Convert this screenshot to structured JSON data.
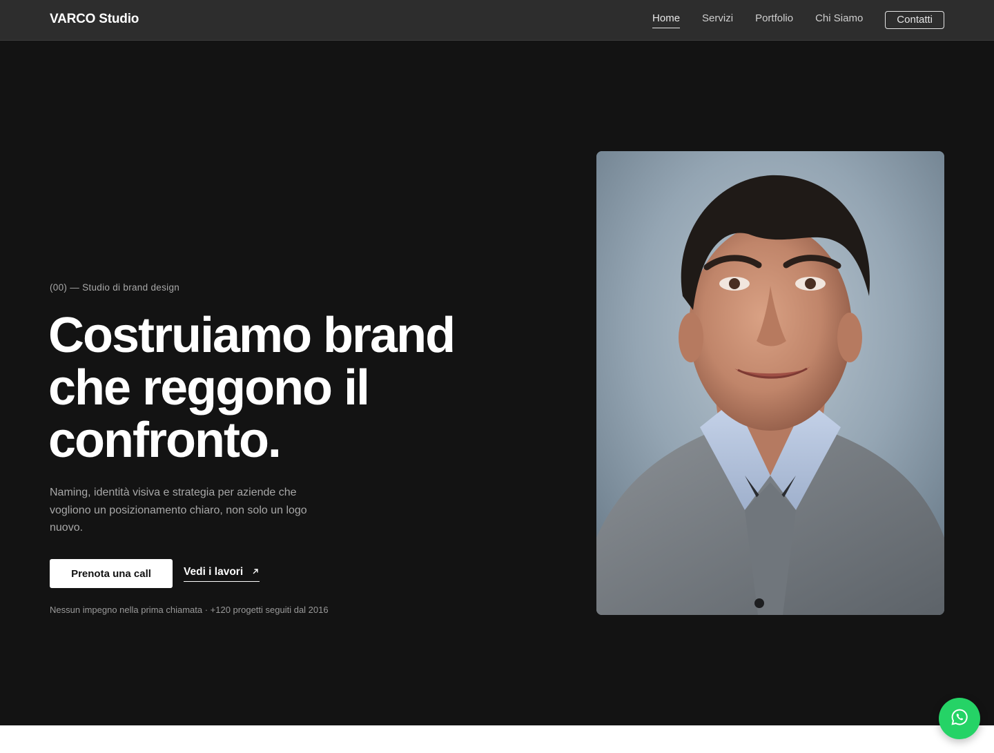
{
  "header": {
    "brand": "VARCO Studio",
    "nav": [
      {
        "label": "Home",
        "active": true
      },
      {
        "label": "Servizi",
        "active": false
      },
      {
        "label": "Portfolio",
        "active": false
      },
      {
        "label": "Chi Siamo",
        "active": false
      }
    ],
    "cta_label": "Contatti"
  },
  "hero": {
    "eyebrow": "(00) — Studio di brand design",
    "headline_lines": [
      "Costruiamo brand",
      "che reggono il",
      "confronto."
    ],
    "lead": "Naming, identità visiva e strategia per aziende che vogliono un posizionamento chiaro, non solo un logo nuovo.",
    "primary_cta": "Prenota una call",
    "secondary_link": "Vedi i lavori",
    "secondary_icon": "arrow-up-right-icon",
    "note": "Nessun impegno nella prima chiamata · +120 progetti seguiti dal 2016",
    "portrait_image": "portrait-photo"
  },
  "fab": {
    "icon": "whatsapp-icon"
  },
  "colors": {
    "nav_bg": "#2d2d2d",
    "hero_bg": "#131313",
    "accent_whatsapp": "#25d366",
    "text_primary": "#ffffff",
    "text_muted": "#a8a8a8"
  }
}
